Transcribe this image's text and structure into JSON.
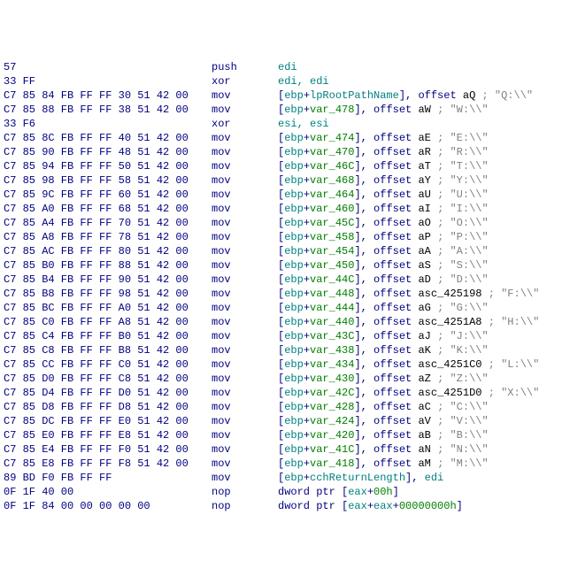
{
  "rows": [
    {
      "hex": "57",
      "mnemonic": "push",
      "op": [
        {
          "t": "edi",
          "c": "cyan"
        }
      ]
    },
    {
      "hex": "33 FF",
      "mnemonic": "xor",
      "op": [
        {
          "t": "edi, edi",
          "c": "cyan"
        }
      ]
    },
    {
      "hex": "C7 85 84 FB FF FF 30 51 42 00",
      "mnemonic": "mov",
      "op": [
        {
          "t": "[",
          "c": "navy"
        },
        {
          "t": "ebp",
          "c": "cyan"
        },
        {
          "t": "+",
          "c": "navy"
        },
        {
          "t": "lpRootPathName",
          "c": "cyan"
        },
        {
          "t": "], ",
          "c": "navy"
        },
        {
          "t": "offset",
          "c": "navy"
        },
        {
          "t": " aQ ",
          "c": "black"
        },
        {
          "t": "; \"Q:\\\\\"",
          "c": "grey"
        }
      ]
    },
    {
      "hex": "C7 85 88 FB FF FF 38 51 42 00",
      "mnemonic": "mov",
      "op": [
        {
          "t": "[",
          "c": "navy"
        },
        {
          "t": "ebp",
          "c": "cyan"
        },
        {
          "t": "+",
          "c": "navy"
        },
        {
          "t": "var_478",
          "c": "green"
        },
        {
          "t": "], ",
          "c": "navy"
        },
        {
          "t": "offset",
          "c": "navy"
        },
        {
          "t": " aW ",
          "c": "black"
        },
        {
          "t": "; \"W:\\\\\"",
          "c": "grey"
        }
      ]
    },
    {
      "hex": "33 F6",
      "mnemonic": "xor",
      "op": [
        {
          "t": "esi, esi",
          "c": "cyan"
        }
      ]
    },
    {
      "hex": "C7 85 8C FB FF FF 40 51 42 00",
      "mnemonic": "mov",
      "op": [
        {
          "t": "[",
          "c": "navy"
        },
        {
          "t": "ebp",
          "c": "cyan"
        },
        {
          "t": "+",
          "c": "navy"
        },
        {
          "t": "var_474",
          "c": "green"
        },
        {
          "t": "], ",
          "c": "navy"
        },
        {
          "t": "offset",
          "c": "navy"
        },
        {
          "t": " aE ",
          "c": "black"
        },
        {
          "t": "; \"E:\\\\\"",
          "c": "grey"
        }
      ]
    },
    {
      "hex": "C7 85 90 FB FF FF 48 51 42 00",
      "mnemonic": "mov",
      "op": [
        {
          "t": "[",
          "c": "navy"
        },
        {
          "t": "ebp",
          "c": "cyan"
        },
        {
          "t": "+",
          "c": "navy"
        },
        {
          "t": "var_470",
          "c": "green"
        },
        {
          "t": "], ",
          "c": "navy"
        },
        {
          "t": "offset",
          "c": "navy"
        },
        {
          "t": " aR ",
          "c": "black"
        },
        {
          "t": "; \"R:\\\\\"",
          "c": "grey"
        }
      ]
    },
    {
      "hex": "C7 85 94 FB FF FF 50 51 42 00",
      "mnemonic": "mov",
      "op": [
        {
          "t": "[",
          "c": "navy"
        },
        {
          "t": "ebp",
          "c": "cyan"
        },
        {
          "t": "+",
          "c": "navy"
        },
        {
          "t": "var_46C",
          "c": "green"
        },
        {
          "t": "], ",
          "c": "navy"
        },
        {
          "t": "offset",
          "c": "navy"
        },
        {
          "t": " aT ",
          "c": "black"
        },
        {
          "t": "; \"T:\\\\\"",
          "c": "grey"
        }
      ]
    },
    {
      "hex": "C7 85 98 FB FF FF 58 51 42 00",
      "mnemonic": "mov",
      "op": [
        {
          "t": "[",
          "c": "navy"
        },
        {
          "t": "ebp",
          "c": "cyan"
        },
        {
          "t": "+",
          "c": "navy"
        },
        {
          "t": "var_468",
          "c": "green"
        },
        {
          "t": "], ",
          "c": "navy"
        },
        {
          "t": "offset",
          "c": "navy"
        },
        {
          "t": " aY ",
          "c": "black"
        },
        {
          "t": "; \"Y:\\\\\"",
          "c": "grey"
        }
      ]
    },
    {
      "hex": "C7 85 9C FB FF FF 60 51 42 00",
      "mnemonic": "mov",
      "op": [
        {
          "t": "[",
          "c": "navy"
        },
        {
          "t": "ebp",
          "c": "cyan"
        },
        {
          "t": "+",
          "c": "navy"
        },
        {
          "t": "var_464",
          "c": "green"
        },
        {
          "t": "], ",
          "c": "navy"
        },
        {
          "t": "offset",
          "c": "navy"
        },
        {
          "t": " aU ",
          "c": "black"
        },
        {
          "t": "; \"U:\\\\\"",
          "c": "grey"
        }
      ]
    },
    {
      "hex": "C7 85 A0 FB FF FF 68 51 42 00",
      "mnemonic": "mov",
      "op": [
        {
          "t": "[",
          "c": "navy"
        },
        {
          "t": "ebp",
          "c": "cyan"
        },
        {
          "t": "+",
          "c": "navy"
        },
        {
          "t": "var_460",
          "c": "green"
        },
        {
          "t": "], ",
          "c": "navy"
        },
        {
          "t": "offset",
          "c": "navy"
        },
        {
          "t": " aI ",
          "c": "black"
        },
        {
          "t": "; \"I:\\\\\"",
          "c": "grey"
        }
      ]
    },
    {
      "hex": "C7 85 A4 FB FF FF 70 51 42 00",
      "mnemonic": "mov",
      "op": [
        {
          "t": "[",
          "c": "navy"
        },
        {
          "t": "ebp",
          "c": "cyan"
        },
        {
          "t": "+",
          "c": "navy"
        },
        {
          "t": "var_45C",
          "c": "green"
        },
        {
          "t": "], ",
          "c": "navy"
        },
        {
          "t": "offset",
          "c": "navy"
        },
        {
          "t": " aO ",
          "c": "black"
        },
        {
          "t": "; \"O:\\\\\"",
          "c": "grey"
        }
      ]
    },
    {
      "hex": "C7 85 A8 FB FF FF 78 51 42 00",
      "mnemonic": "mov",
      "op": [
        {
          "t": "[",
          "c": "navy"
        },
        {
          "t": "ebp",
          "c": "cyan"
        },
        {
          "t": "+",
          "c": "navy"
        },
        {
          "t": "var_458",
          "c": "green"
        },
        {
          "t": "], ",
          "c": "navy"
        },
        {
          "t": "offset",
          "c": "navy"
        },
        {
          "t": " aP ",
          "c": "black"
        },
        {
          "t": "; \"P:\\\\\"",
          "c": "grey"
        }
      ]
    },
    {
      "hex": "C7 85 AC FB FF FF 80 51 42 00",
      "mnemonic": "mov",
      "op": [
        {
          "t": "[",
          "c": "navy"
        },
        {
          "t": "ebp",
          "c": "cyan"
        },
        {
          "t": "+",
          "c": "navy"
        },
        {
          "t": "var_454",
          "c": "green"
        },
        {
          "t": "], ",
          "c": "navy"
        },
        {
          "t": "offset",
          "c": "navy"
        },
        {
          "t": " aA ",
          "c": "black"
        },
        {
          "t": "; \"A:\\\\\"",
          "c": "grey"
        }
      ]
    },
    {
      "hex": "C7 85 B0 FB FF FF 88 51 42 00",
      "mnemonic": "mov",
      "op": [
        {
          "t": "[",
          "c": "navy"
        },
        {
          "t": "ebp",
          "c": "cyan"
        },
        {
          "t": "+",
          "c": "navy"
        },
        {
          "t": "var_450",
          "c": "green"
        },
        {
          "t": "], ",
          "c": "navy"
        },
        {
          "t": "offset",
          "c": "navy"
        },
        {
          "t": " aS ",
          "c": "black"
        },
        {
          "t": "; \"S:\\\\\"",
          "c": "grey"
        }
      ]
    },
    {
      "hex": "C7 85 B4 FB FF FF 90 51 42 00",
      "mnemonic": "mov",
      "op": [
        {
          "t": "[",
          "c": "navy"
        },
        {
          "t": "ebp",
          "c": "cyan"
        },
        {
          "t": "+",
          "c": "navy"
        },
        {
          "t": "var_44C",
          "c": "green"
        },
        {
          "t": "], ",
          "c": "navy"
        },
        {
          "t": "offset",
          "c": "navy"
        },
        {
          "t": " aD ",
          "c": "black"
        },
        {
          "t": "; \"D:\\\\\"",
          "c": "grey"
        }
      ]
    },
    {
      "hex": "C7 85 B8 FB FF FF 98 51 42 00",
      "mnemonic": "mov",
      "op": [
        {
          "t": "[",
          "c": "navy"
        },
        {
          "t": "ebp",
          "c": "cyan"
        },
        {
          "t": "+",
          "c": "navy"
        },
        {
          "t": "var_448",
          "c": "green"
        },
        {
          "t": "], ",
          "c": "navy"
        },
        {
          "t": "offset",
          "c": "navy"
        },
        {
          "t": " asc_425198 ",
          "c": "black"
        },
        {
          "t": "; \"F:\\\\\"",
          "c": "grey"
        }
      ]
    },
    {
      "hex": "C7 85 BC FB FF FF A0 51 42 00",
      "mnemonic": "mov",
      "op": [
        {
          "t": "[",
          "c": "navy"
        },
        {
          "t": "ebp",
          "c": "cyan"
        },
        {
          "t": "+",
          "c": "navy"
        },
        {
          "t": "var_444",
          "c": "green"
        },
        {
          "t": "], ",
          "c": "navy"
        },
        {
          "t": "offset",
          "c": "navy"
        },
        {
          "t": " aG ",
          "c": "black"
        },
        {
          "t": "; \"G:\\\\\"",
          "c": "grey"
        }
      ]
    },
    {
      "hex": "C7 85 C0 FB FF FF A8 51 42 00",
      "mnemonic": "mov",
      "op": [
        {
          "t": "[",
          "c": "navy"
        },
        {
          "t": "ebp",
          "c": "cyan"
        },
        {
          "t": "+",
          "c": "navy"
        },
        {
          "t": "var_440",
          "c": "green"
        },
        {
          "t": "], ",
          "c": "navy"
        },
        {
          "t": "offset",
          "c": "navy"
        },
        {
          "t": " asc_4251A8 ",
          "c": "black"
        },
        {
          "t": "; \"H:\\\\\"",
          "c": "grey"
        }
      ]
    },
    {
      "hex": "C7 85 C4 FB FF FF B0 51 42 00",
      "mnemonic": "mov",
      "op": [
        {
          "t": "[",
          "c": "navy"
        },
        {
          "t": "ebp",
          "c": "cyan"
        },
        {
          "t": "+",
          "c": "navy"
        },
        {
          "t": "var_43C",
          "c": "green"
        },
        {
          "t": "], ",
          "c": "navy"
        },
        {
          "t": "offset",
          "c": "navy"
        },
        {
          "t": " aJ ",
          "c": "black"
        },
        {
          "t": "; \"J:\\\\\"",
          "c": "grey"
        }
      ]
    },
    {
      "hex": "C7 85 C8 FB FF FF B8 51 42 00",
      "mnemonic": "mov",
      "op": [
        {
          "t": "[",
          "c": "navy"
        },
        {
          "t": "ebp",
          "c": "cyan"
        },
        {
          "t": "+",
          "c": "navy"
        },
        {
          "t": "var_438",
          "c": "green"
        },
        {
          "t": "], ",
          "c": "navy"
        },
        {
          "t": "offset",
          "c": "navy"
        },
        {
          "t": " aK ",
          "c": "black"
        },
        {
          "t": "; \"K:\\\\\"",
          "c": "grey"
        }
      ]
    },
    {
      "hex": "C7 85 CC FB FF FF C0 51 42 00",
      "mnemonic": "mov",
      "op": [
        {
          "t": "[",
          "c": "navy"
        },
        {
          "t": "ebp",
          "c": "cyan"
        },
        {
          "t": "+",
          "c": "navy"
        },
        {
          "t": "var_434",
          "c": "green"
        },
        {
          "t": "], ",
          "c": "navy"
        },
        {
          "t": "offset",
          "c": "navy"
        },
        {
          "t": " asc_4251C0 ",
          "c": "black"
        },
        {
          "t": "; \"L:\\\\\"",
          "c": "grey"
        }
      ]
    },
    {
      "hex": "C7 85 D0 FB FF FF C8 51 42 00",
      "mnemonic": "mov",
      "op": [
        {
          "t": "[",
          "c": "navy"
        },
        {
          "t": "ebp",
          "c": "cyan"
        },
        {
          "t": "+",
          "c": "navy"
        },
        {
          "t": "var_430",
          "c": "green"
        },
        {
          "t": "], ",
          "c": "navy"
        },
        {
          "t": "offset",
          "c": "navy"
        },
        {
          "t": " aZ ",
          "c": "black"
        },
        {
          "t": "; \"Z:\\\\\"",
          "c": "grey"
        }
      ]
    },
    {
      "hex": "C7 85 D4 FB FF FF D0 51 42 00",
      "mnemonic": "mov",
      "op": [
        {
          "t": "[",
          "c": "navy"
        },
        {
          "t": "ebp",
          "c": "cyan"
        },
        {
          "t": "+",
          "c": "navy"
        },
        {
          "t": "var_42C",
          "c": "green"
        },
        {
          "t": "], ",
          "c": "navy"
        },
        {
          "t": "offset",
          "c": "navy"
        },
        {
          "t": " asc_4251D0 ",
          "c": "black"
        },
        {
          "t": "; \"X:\\\\\"",
          "c": "grey"
        }
      ]
    },
    {
      "hex": "C7 85 D8 FB FF FF D8 51 42 00",
      "mnemonic": "mov",
      "op": [
        {
          "t": "[",
          "c": "navy"
        },
        {
          "t": "ebp",
          "c": "cyan"
        },
        {
          "t": "+",
          "c": "navy"
        },
        {
          "t": "var_428",
          "c": "green"
        },
        {
          "t": "], ",
          "c": "navy"
        },
        {
          "t": "offset",
          "c": "navy"
        },
        {
          "t": " aC ",
          "c": "black"
        },
        {
          "t": "; \"C:\\\\\"",
          "c": "grey"
        }
      ]
    },
    {
      "hex": "C7 85 DC FB FF FF E0 51 42 00",
      "mnemonic": "mov",
      "op": [
        {
          "t": "[",
          "c": "navy"
        },
        {
          "t": "ebp",
          "c": "cyan"
        },
        {
          "t": "+",
          "c": "navy"
        },
        {
          "t": "var_424",
          "c": "green"
        },
        {
          "t": "], ",
          "c": "navy"
        },
        {
          "t": "offset",
          "c": "navy"
        },
        {
          "t": " aV ",
          "c": "black"
        },
        {
          "t": "; \"V:\\\\\"",
          "c": "grey"
        }
      ]
    },
    {
      "hex": "C7 85 E0 FB FF FF E8 51 42 00",
      "mnemonic": "mov",
      "op": [
        {
          "t": "[",
          "c": "navy"
        },
        {
          "t": "ebp",
          "c": "cyan"
        },
        {
          "t": "+",
          "c": "navy"
        },
        {
          "t": "var_420",
          "c": "green"
        },
        {
          "t": "], ",
          "c": "navy"
        },
        {
          "t": "offset",
          "c": "navy"
        },
        {
          "t": " aB ",
          "c": "black"
        },
        {
          "t": "; \"B:\\\\\"",
          "c": "grey"
        }
      ]
    },
    {
      "hex": "C7 85 E4 FB FF FF F0 51 42 00",
      "mnemonic": "mov",
      "op": [
        {
          "t": "[",
          "c": "navy"
        },
        {
          "t": "ebp",
          "c": "cyan"
        },
        {
          "t": "+",
          "c": "navy"
        },
        {
          "t": "var_41C",
          "c": "green"
        },
        {
          "t": "], ",
          "c": "navy"
        },
        {
          "t": "offset",
          "c": "navy"
        },
        {
          "t": " aN ",
          "c": "black"
        },
        {
          "t": "; \"N:\\\\\"",
          "c": "grey"
        }
      ]
    },
    {
      "hex": "C7 85 E8 FB FF FF F8 51 42 00",
      "mnemonic": "mov",
      "op": [
        {
          "t": "[",
          "c": "navy"
        },
        {
          "t": "ebp",
          "c": "cyan"
        },
        {
          "t": "+",
          "c": "navy"
        },
        {
          "t": "var_418",
          "c": "green"
        },
        {
          "t": "], ",
          "c": "navy"
        },
        {
          "t": "offset",
          "c": "navy"
        },
        {
          "t": " aM ",
          "c": "black"
        },
        {
          "t": "; \"M:\\\\\"",
          "c": "grey"
        }
      ]
    },
    {
      "hex": "89 BD F0 FB FF FF",
      "mnemonic": "mov",
      "op": [
        {
          "t": "[",
          "c": "navy"
        },
        {
          "t": "ebp",
          "c": "cyan"
        },
        {
          "t": "+",
          "c": "navy"
        },
        {
          "t": "cchReturnLength",
          "c": "cyan"
        },
        {
          "t": "], ",
          "c": "navy"
        },
        {
          "t": "edi",
          "c": "cyan"
        }
      ]
    },
    {
      "hex": "0F 1F 40 00",
      "mnemonic": "nop",
      "op": [
        {
          "t": "dword ptr",
          "c": "navy"
        },
        {
          "t": " [",
          "c": "navy"
        },
        {
          "t": "eax",
          "c": "cyan"
        },
        {
          "t": "+",
          "c": "navy"
        },
        {
          "t": "00h",
          "c": "green"
        },
        {
          "t": "]",
          "c": "navy"
        }
      ]
    },
    {
      "hex": "0F 1F 84 00 00 00 00 00",
      "mnemonic": "nop",
      "op": [
        {
          "t": "dword ptr",
          "c": "navy"
        },
        {
          "t": " [",
          "c": "navy"
        },
        {
          "t": "eax",
          "c": "cyan"
        },
        {
          "t": "+",
          "c": "navy"
        },
        {
          "t": "eax",
          "c": "cyan"
        },
        {
          "t": "+",
          "c": "navy"
        },
        {
          "t": "00000000h",
          "c": "green"
        },
        {
          "t": "]",
          "c": "navy"
        }
      ]
    }
  ]
}
